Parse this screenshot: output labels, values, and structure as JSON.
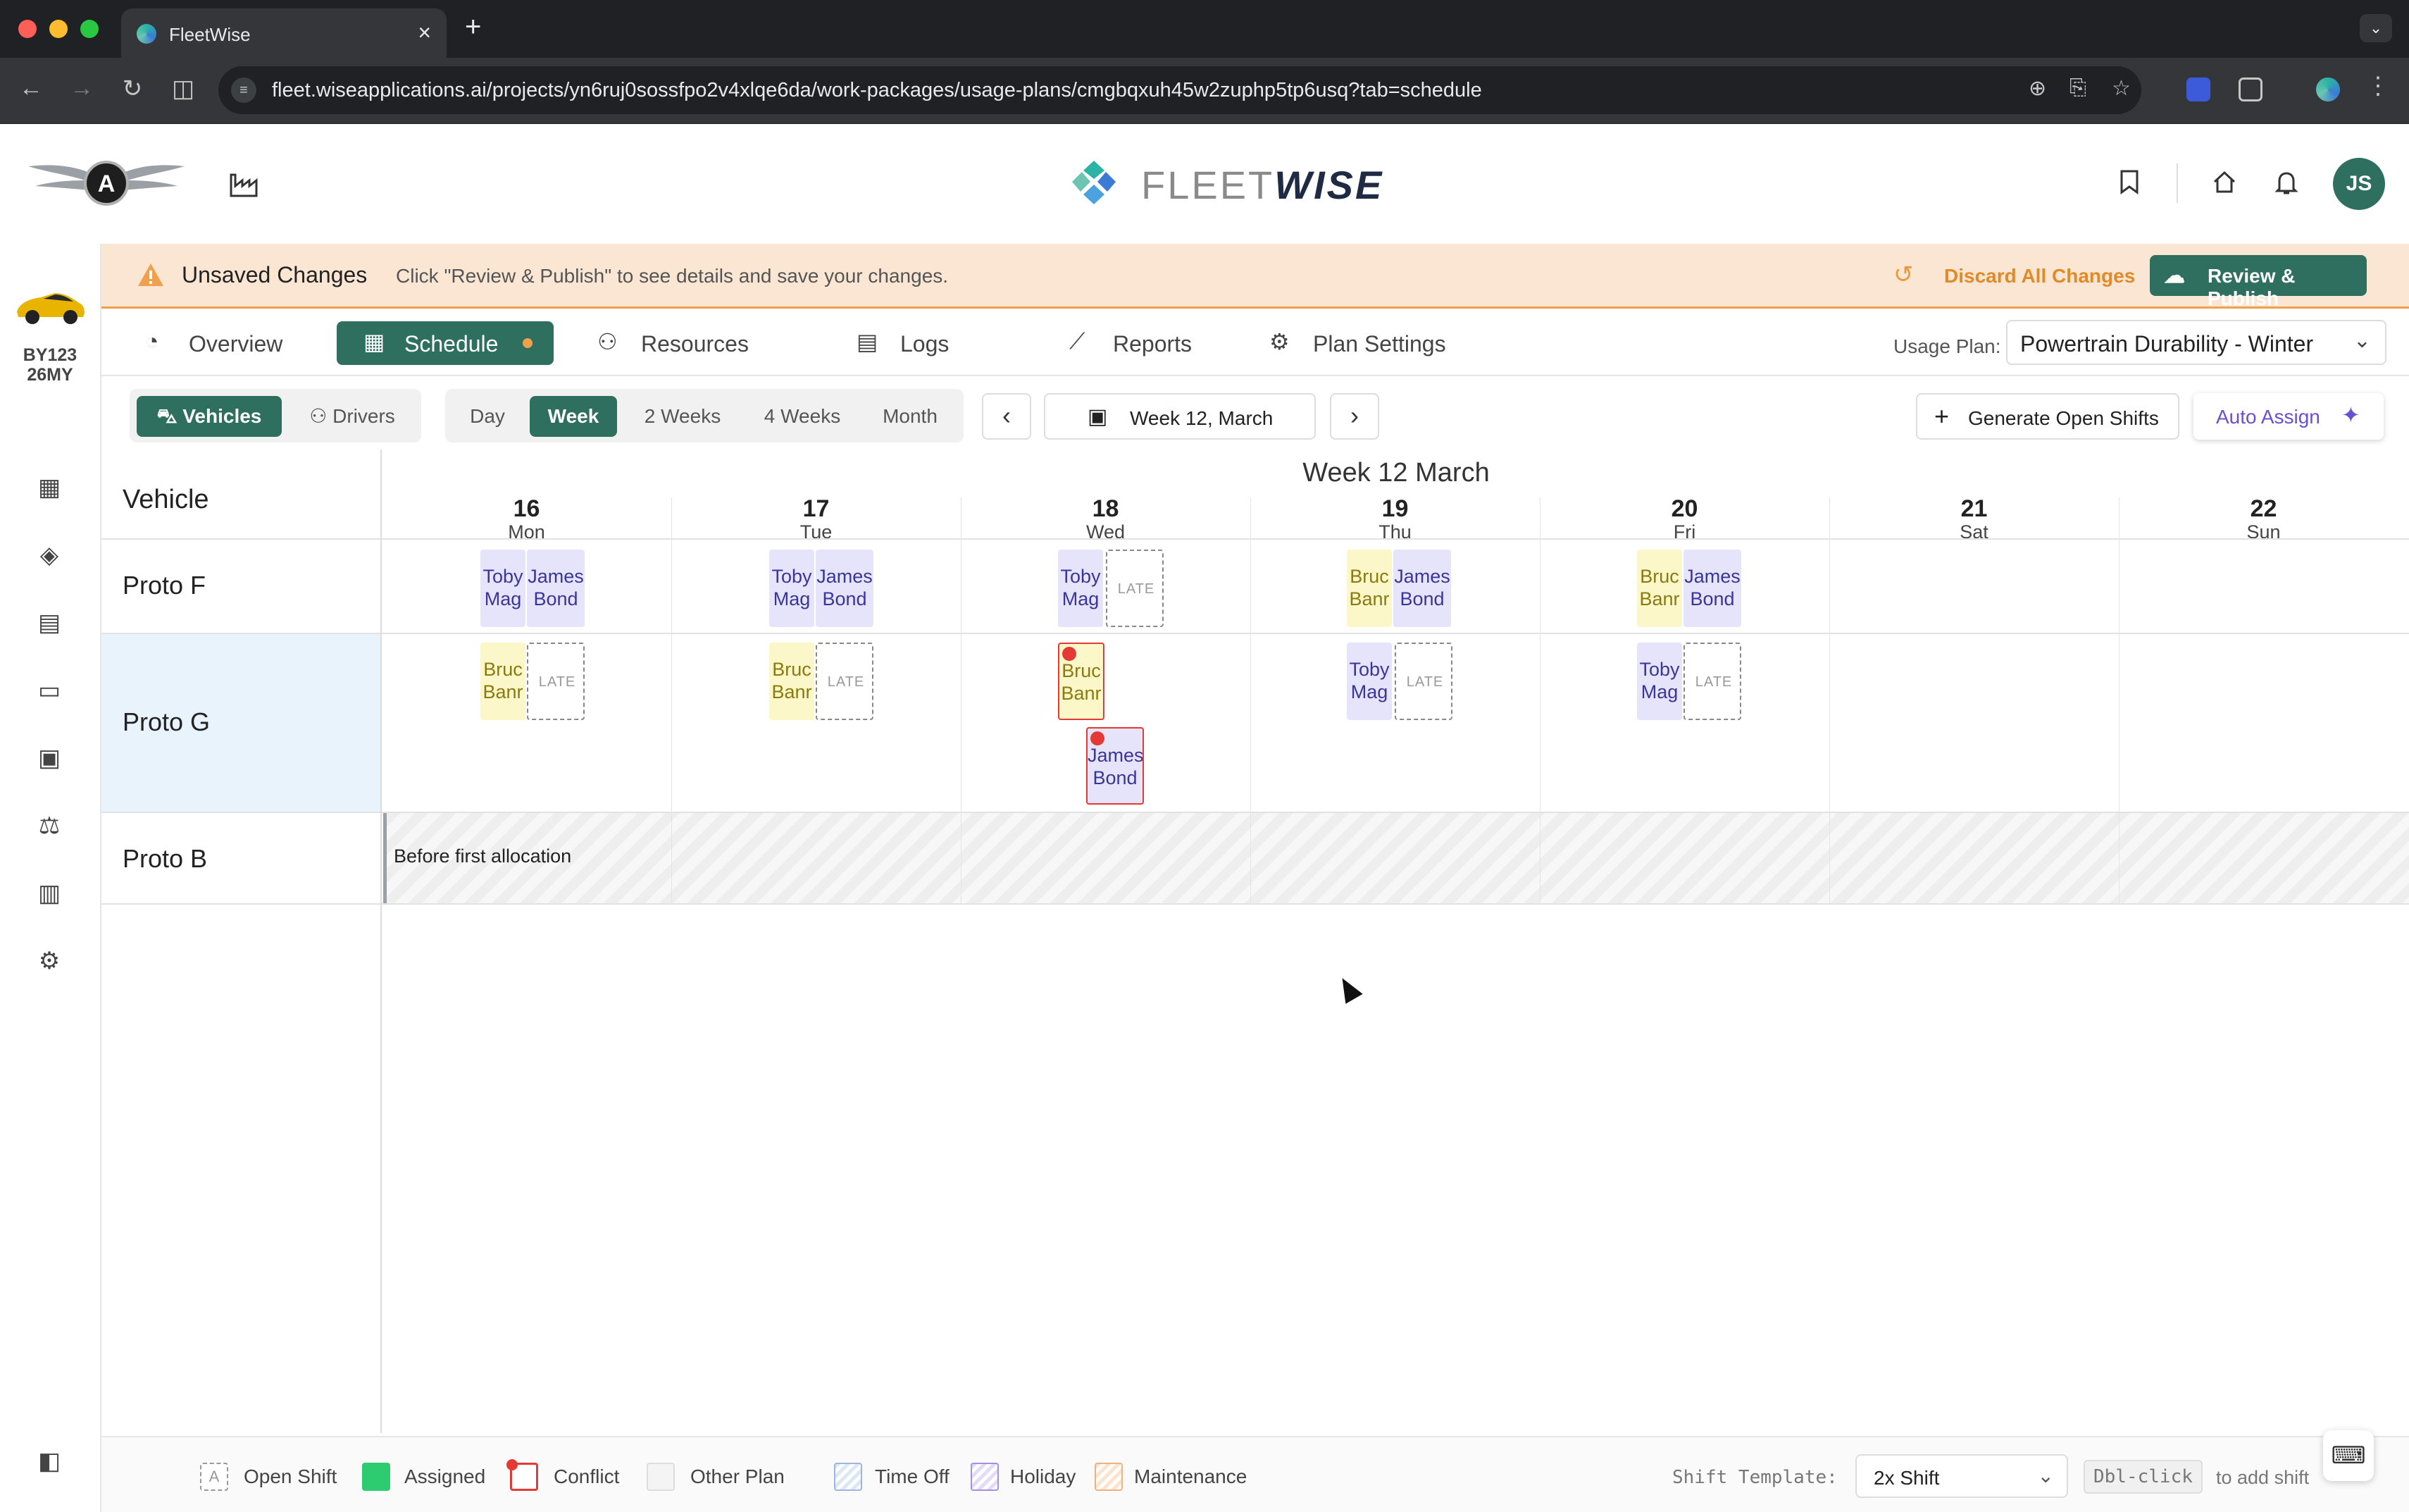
{
  "browser": {
    "tab_title": "FleetWise",
    "url": "fleet.wiseapplications.ai/projects/yn6ruj0sossfpo2v4xlqe6da/work-packages/usage-plans/cmgbqxuh45w2zuphp5tp6usq?tab=schedule"
  },
  "brand": {
    "name_light": "FLEET",
    "name_bold": "WISE"
  },
  "user": {
    "initials": "JS"
  },
  "vehicle_badge": {
    "line1": "BY123",
    "line2": "26MY"
  },
  "banner": {
    "title": "Unsaved Changes",
    "message": "Click \"Review & Publish\" to see details and save your changes.",
    "discard_label": "Discard All Changes",
    "publish_label": "Review & Publish"
  },
  "tabs": [
    {
      "label": "Overview",
      "icon": "gauge-icon"
    },
    {
      "label": "Schedule",
      "icon": "calendar-icon"
    },
    {
      "label": "Resources",
      "icon": "motorbike-icon"
    },
    {
      "label": "Logs",
      "icon": "clipboard-icon"
    },
    {
      "label": "Reports",
      "icon": "chart-line-icon"
    },
    {
      "label": "Plan Settings",
      "icon": "gear-icon"
    }
  ],
  "usage_plan": {
    "label": "Usage Plan:",
    "value": "Powertrain Durability - Winter"
  },
  "view_toggle": {
    "vehicles": "Vehicles",
    "drivers": "Drivers"
  },
  "range": {
    "day": "Day",
    "week": "Week",
    "two_weeks": "2 Weeks",
    "four_weeks": "4 Weeks",
    "month": "Month"
  },
  "week_label": "Week 12, March",
  "generate_label": "Generate Open Shifts",
  "auto_assign_label": "Auto Assign",
  "grid": {
    "vehicle_header": "Vehicle",
    "week_title": "Week 12 March",
    "days": [
      {
        "num": "16",
        "name": "Mon"
      },
      {
        "num": "17",
        "name": "Tue"
      },
      {
        "num": "18",
        "name": "Wed"
      },
      {
        "num": "19",
        "name": "Thu"
      },
      {
        "num": "20",
        "name": "Fri"
      },
      {
        "num": "21",
        "name": "Sat"
      },
      {
        "num": "22",
        "name": "Sun"
      }
    ],
    "rows": [
      "Proto F",
      "Proto G",
      "Proto B"
    ],
    "before_first_allocation": "Before first allocation",
    "late": "LATE",
    "names": {
      "toby1": "Toby",
      "toby2": "Mag",
      "james1": "James",
      "james2": "Bond",
      "bruce1": "Bruc",
      "bruce2": "Banr"
    }
  },
  "legend": {
    "open_shift": "Open Shift",
    "open_shift_mark": "A",
    "assigned": "Assigned",
    "conflict": "Conflict",
    "other_plan": "Other Plan",
    "time_off": "Time Off",
    "holiday": "Holiday",
    "maintenance": "Maintenance",
    "shift_template_label": "Shift Template:",
    "shift_template_value": "2x Shift",
    "dblclick": "Dbl-click",
    "dblclick_note": "to add shift"
  },
  "colors": {
    "primary": "#2f6f5f",
    "warning_bg": "#fbe6d3",
    "warning_accent": "#f0a04b",
    "assigned_purple": "#e6e4fb",
    "assigned_yellow": "#fcf7c8",
    "conflict": "#e53935",
    "auto_assign": "#6b4fd1"
  }
}
